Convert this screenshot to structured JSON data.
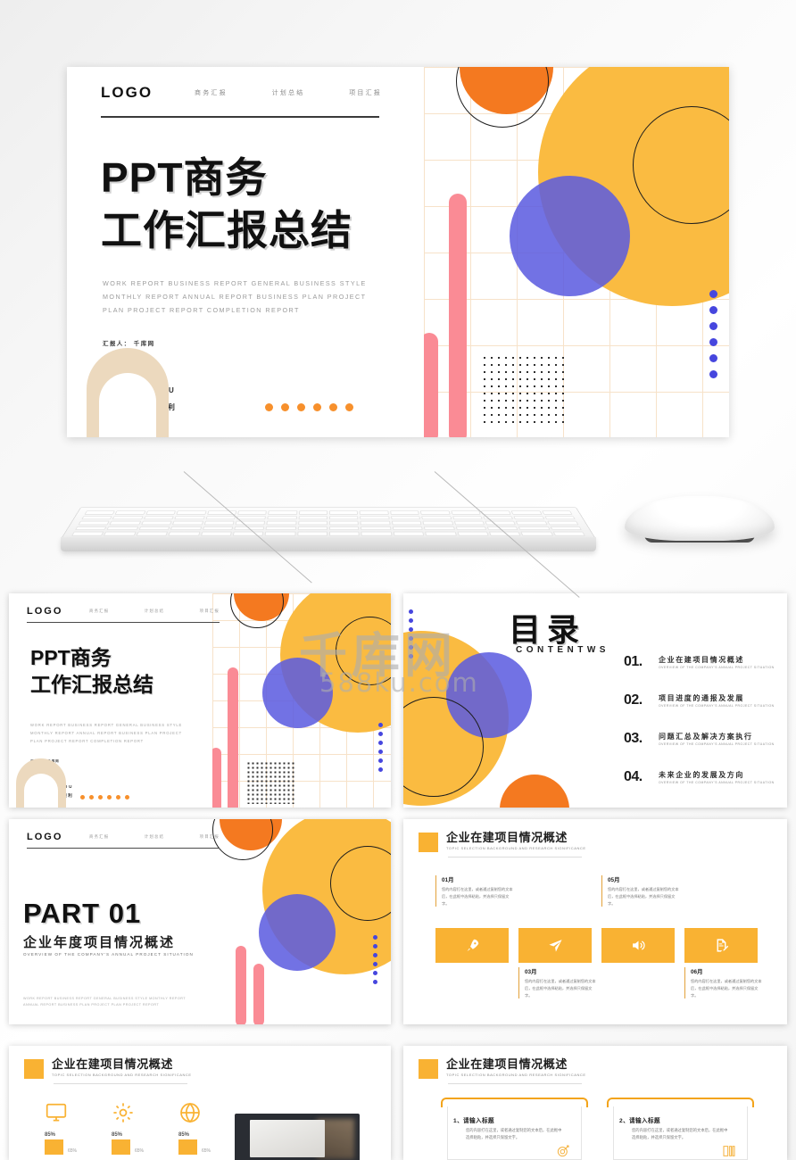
{
  "brand": {
    "logo": "LOGO",
    "accent_yellow": "#FABB41",
    "accent_orange": "#F47920",
    "accent_blue": "#5B5BE0",
    "accent_pink": "#FA8B95",
    "accent_gold": "#F9B233"
  },
  "nav": {
    "items": [
      "商务汇报",
      "计划总结",
      "项目汇报"
    ]
  },
  "hero": {
    "title_line1": "PPT商务",
    "title_line2": "工作汇报总结",
    "english_line1": "WORK REPORT BUSINESS REPORT GENERAL BUSINESS STYLE",
    "english_line2": "MONTHLY REPORT ANNUAL REPORT BUSINESS PLAN PROJECT",
    "english_line3": "PLAN PROJECT REPORT COMPLETION REPORT",
    "reporter": "汇报人： 千库网",
    "thanks": "THANKS YOU",
    "year": "2021 · 工作顺利"
  },
  "watermark": {
    "cn": "千库网",
    "en": "588ku.com"
  },
  "toc": {
    "title": "目录",
    "subtitle": "CONTENTWS",
    "items": [
      {
        "num": "01.",
        "cn": "企业在建项目情况概述",
        "en": "OVERVIEW OF THE COMPANY'S ANNUAL PROJECT SITUATION"
      },
      {
        "num": "02.",
        "cn": "项目进度的通报及发展",
        "en": "OVERVIEW OF THE COMPANY'S ANNUAL PROJECT SITUATION"
      },
      {
        "num": "03.",
        "cn": "问题汇总及解决方案执行",
        "en": "OVERVIEW OF THE COMPANY'S ANNUAL PROJECT SITUATION"
      },
      {
        "num": "04.",
        "cn": "未来企业的发展及方向",
        "en": "OVERVIEW OF THE COMPANY'S ANNUAL PROJECT SITUATION"
      }
    ]
  },
  "part": {
    "label": "PART 01",
    "cn": "企业年度项目情况概述",
    "en": "OVERVIEW OF THE COMPANY'S ANNUAL PROJECT SITUATION",
    "footer_line1": "WORK REPORT BUSINESS REPORT GENERAL BUSINESS STYLE MONTHLY REPORT",
    "footer_line2": "ANNUAL REPORT BUSINESS PLAN PROJECT PLAN PROJECT REPORT"
  },
  "content_header": {
    "cn": "企业在建项目情况概述",
    "en": "TOPIC SELECTION BACKGROUND AND RESEARCH SIGNIFICANCE"
  },
  "months": {
    "body": "您的内容打在这里，或者通过复制您的文本后，在此框中选择粘贴，并选择只保留文字。",
    "cards": [
      {
        "label": "01月",
        "icon": "rocket-icon"
      },
      {
        "label": "03月",
        "icon": "paper-plane-icon"
      },
      {
        "label": "05月",
        "icon": "speaker-icon"
      },
      {
        "label": "06月",
        "icon": "document-edit-icon"
      }
    ]
  },
  "stats": {
    "items": [
      {
        "icon": "monitor-icon",
        "percent": "85%",
        "percent2": "65%"
      },
      {
        "icon": "gear-icon",
        "percent": "85%",
        "percent2": "65%"
      },
      {
        "icon": "globe-icon",
        "percent": "85%",
        "percent2": "65%"
      }
    ]
  },
  "tabcards": {
    "body": "您的内容打在这里，或者通过复制您的文本后，在此框中选择粘贴，并选择只保留文字。",
    "items": [
      {
        "title": "1、请输入标题",
        "icon": "target-icon"
      },
      {
        "title": "2、请输入标题",
        "icon": "list-icon"
      }
    ]
  }
}
